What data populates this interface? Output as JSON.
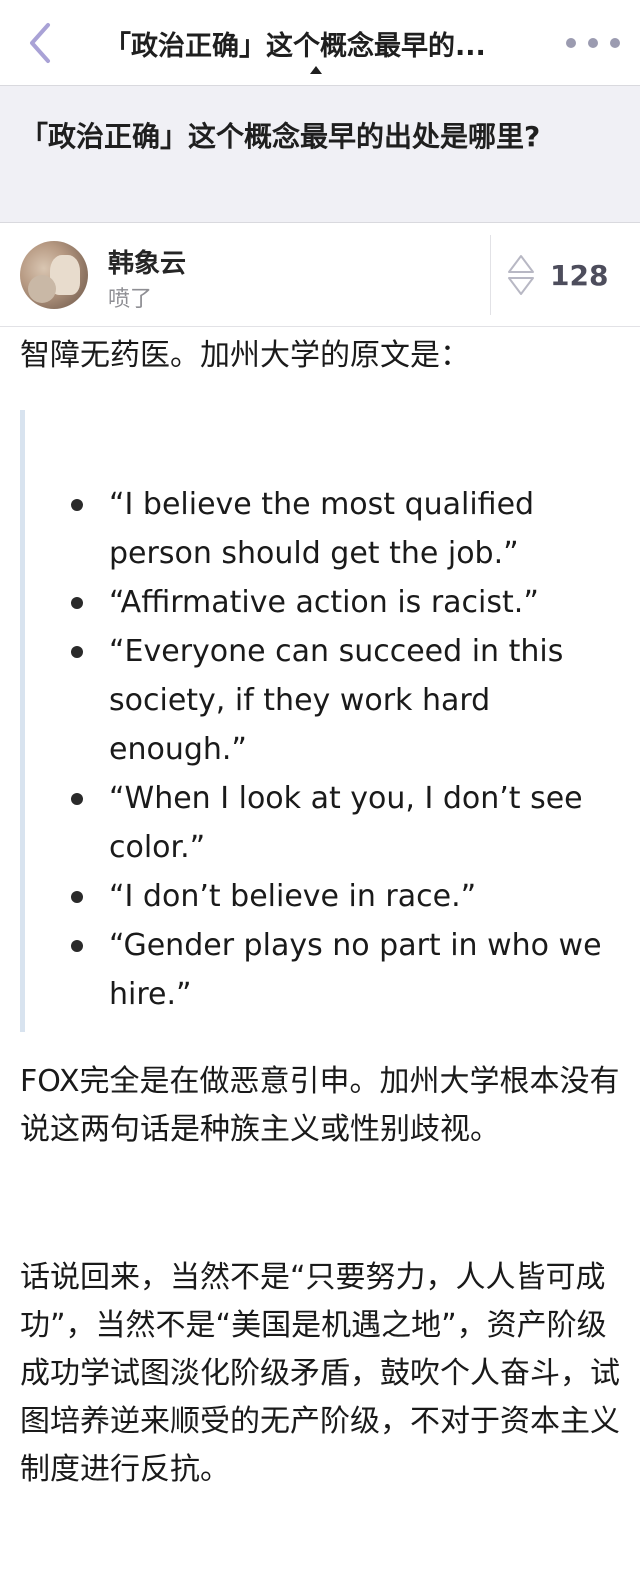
{
  "navbar": {
    "title": "「政治正确」这个概念最早的...",
    "back_icon": "chevron-left-icon",
    "more_icon": "more-dots-icon",
    "accent_color": "#a9a2d6"
  },
  "question": {
    "title": "「政治正确」这个概念最早的出处是哪里?"
  },
  "author": {
    "name": "韩象云",
    "bio": "喷了",
    "votes": "128"
  },
  "answer": {
    "intro": "智障无药医。加州大学的原文是：",
    "quote_items": [
      "“I believe the most qualified person should get the job.”",
      "“Affirmative action is racist.”",
      "“Everyone can succeed in this society, if they work hard enough.”",
      "“When I look at you, I don’t see color.”",
      "“I don’t believe in race.”",
      "“Gender plays no part in who we hire.”"
    ],
    "paragraph1": "FOX完全是在做恶意引申。加州大学根本没有说这两句话是种族主义或性别歧视。",
    "paragraph2": "话说回来，当然不是“只要努力，人人皆可成功”，当然不是“美国是机遇之地”，资产阶级成功学试图淡化阶级矛盾，鼓吹个人奋斗，试图培养逆来顺受的无产阶级，不对于资本主义制度进行反抗。"
  }
}
